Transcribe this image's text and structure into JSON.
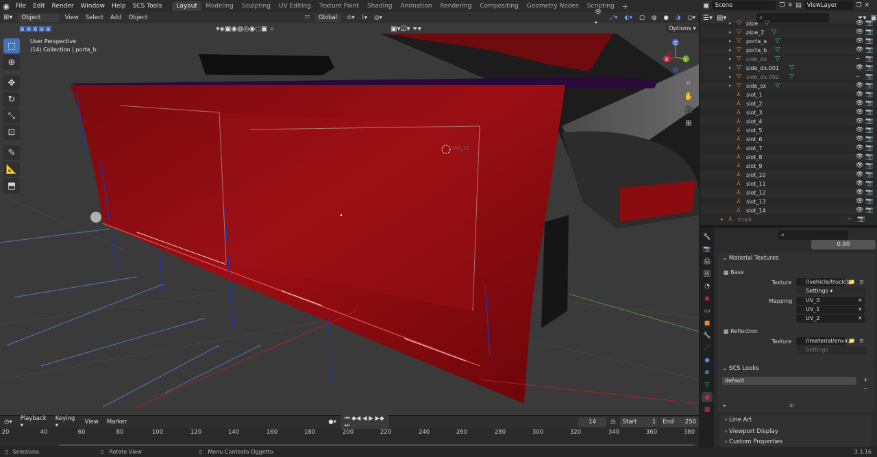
{
  "topbar": {
    "menus": [
      "File",
      "Edit",
      "Render",
      "Window",
      "Help",
      "SCS Tools"
    ],
    "workspaces": [
      "Layout",
      "Modeling",
      "Sculpting",
      "UV Editing",
      "Texture Paint",
      "Shading",
      "Animation",
      "Rendering",
      "Compositing",
      "Geometry Nodes",
      "Scripting"
    ],
    "active_workspace": "Layout",
    "scene": "Scene",
    "view_layer": "ViewLayer"
  },
  "viewport_header": {
    "mode": "Object Mode",
    "menus": [
      "View",
      "Select",
      "Add",
      "Object"
    ],
    "transform_orientation": "Global",
    "options": "Options"
  },
  "viewport": {
    "perspective": "User Perspective",
    "collection": "(14) Collection | porta_b",
    "empty_label": "slot_11"
  },
  "timeline": {
    "menus": [
      "Playback",
      "Keying",
      "View",
      "Marker"
    ],
    "current_frame": "14",
    "start_label": "Start",
    "start": "1",
    "end_label": "End",
    "end": "250",
    "ruler": [
      "20",
      "40",
      "60",
      "80",
      "100",
      "120",
      "140",
      "160",
      "180",
      "200",
      "220",
      "240",
      "260",
      "280",
      "300",
      "320",
      "340",
      "360",
      "380"
    ]
  },
  "statusbar": {
    "select": "Seleziona",
    "rotate": "Rotate View",
    "context": "Menu Contesto Oggetto",
    "version": "3.3.16"
  },
  "outliner": {
    "rows": [
      {
        "name": "pipe",
        "type": "mesh",
        "dim": false
      },
      {
        "name": "pipe_2",
        "type": "mesh",
        "dim": false
      },
      {
        "name": "porta_a",
        "type": "mesh",
        "dim": false
      },
      {
        "name": "porta_b",
        "type": "mesh",
        "dim": false
      },
      {
        "name": "side_dx",
        "type": "mesh",
        "dim": true
      },
      {
        "name": "side_dx.001",
        "type": "mesh",
        "dim": false
      },
      {
        "name": "side_dx.002",
        "type": "mesh",
        "dim": true
      },
      {
        "name": "side_sx",
        "type": "mesh",
        "dim": false
      },
      {
        "name": "slot_1",
        "type": "empty",
        "dim": false
      },
      {
        "name": "slot_2",
        "type": "empty",
        "dim": false
      },
      {
        "name": "slot_3",
        "type": "empty",
        "dim": false
      },
      {
        "name": "slot_4",
        "type": "empty",
        "dim": false
      },
      {
        "name": "slot_5",
        "type": "empty",
        "dim": false
      },
      {
        "name": "slot_6",
        "type": "empty",
        "dim": false
      },
      {
        "name": "slot_7",
        "type": "empty",
        "dim": false
      },
      {
        "name": "slot_8",
        "type": "empty",
        "dim": false
      },
      {
        "name": "slot_9",
        "type": "empty",
        "dim": false
      },
      {
        "name": "slot_10",
        "type": "empty",
        "dim": false
      },
      {
        "name": "slot_11",
        "type": "empty",
        "dim": false
      },
      {
        "name": "slot_12",
        "type": "empty",
        "dim": false
      },
      {
        "name": "slot_13",
        "type": "empty",
        "dim": false
      },
      {
        "name": "slot_14",
        "type": "empty",
        "dim": false
      },
      {
        "name": "truck",
        "type": "armature",
        "dim": true
      }
    ]
  },
  "properties": {
    "value_field": "0.90",
    "material_textures": "Material Textures",
    "base": "Base",
    "texture_label": "Texture",
    "base_texture": "//vehicle/truck/s...",
    "settings": "Settings",
    "mapping_label": "Mapping",
    "uv": [
      "UV_0",
      "UV_1",
      "UV_2"
    ],
    "reflection": "Reflection",
    "reflection_texture": "//material/envir...",
    "scs_looks": "SCS Looks",
    "look_default": "default",
    "line_art": "Line Art",
    "viewport_display": "Viewport Display",
    "custom_properties": "Custom Properties"
  }
}
